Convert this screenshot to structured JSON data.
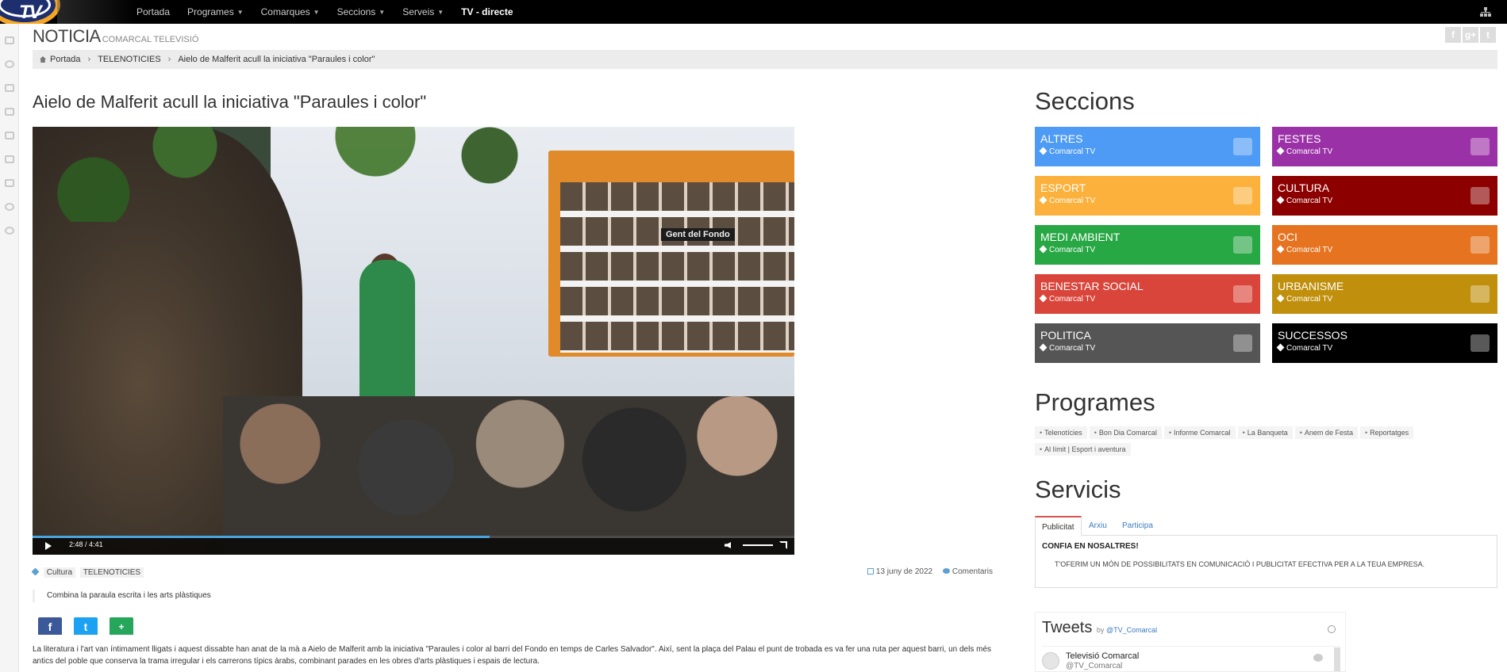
{
  "nav": {
    "logo_text": "TV",
    "items": [
      {
        "label": "Portada",
        "dropdown": false
      },
      {
        "label": "Programes",
        "dropdown": true
      },
      {
        "label": "Comarques",
        "dropdown": true
      },
      {
        "label": "Seccions",
        "dropdown": true
      },
      {
        "label": "Serveis",
        "dropdown": true
      },
      {
        "label": "TV - directe",
        "dropdown": false
      }
    ]
  },
  "header": {
    "title": "NOTICIA",
    "subtitle": "COMARCAL TELEVISIÓ",
    "social": [
      "f",
      "g+",
      "t"
    ]
  },
  "breadcrumb": [
    "Portada",
    "TELENOTICIES",
    "Aielo de Malferit acull la iniciativa \"Paraules i color\""
  ],
  "article": {
    "title": "Aielo de Malferit acull la iniciativa \"Paraules i color\"",
    "video": {
      "board_label": "Gent del Fondo",
      "current_time": "2:48",
      "time_separator": "/",
      "duration": "4:41",
      "progress": 0.6
    },
    "tags": [
      "Cultura",
      "TELENOTICIES"
    ],
    "date": "13 juny de 2022",
    "comments_label": "Comentaris",
    "lead": "Combina la paraula escrita i les arts plàstiques",
    "share": [
      "f",
      "t",
      "+"
    ],
    "body": "La literatura i l'art van íntimament lligats i aquest dissabte han anat de la mà a Aielo de Malferit amb la iniciativa \"Paraules i color al barri del Fondo en temps de Carles Salvador\". Així, sent la plaça del Palau el punt de trobada es va fer una ruta per aquest barri, un dels més antics del poble que conserva la trama irregular i els carrerons típics àrabs, combinant parades en les obres d'arts plàstiques i espais de lectura."
  },
  "sidebar": {
    "sections_title": "Seccions",
    "sections": [
      {
        "name": "ALTRES",
        "sub": "Comarcal TV",
        "color": "#4d9bf5",
        "icon": "globe-icon"
      },
      {
        "name": "FESTES",
        "sub": "Comarcal TV",
        "color": "#9b31a7",
        "icon": "bullhorn-icon"
      },
      {
        "name": "ESPORT",
        "sub": "Comarcal TV",
        "color": "#fbb13c",
        "icon": "trophy-icon"
      },
      {
        "name": "CULTURA",
        "sub": "Comarcal TV",
        "color": "#8c0000",
        "icon": "book-icon"
      },
      {
        "name": "MEDI AMBIENT",
        "sub": "Comarcal TV",
        "color": "#28a745",
        "icon": "plane-icon"
      },
      {
        "name": "OCI",
        "sub": "Comarcal TV",
        "color": "#e5731f",
        "icon": "glass-icon"
      },
      {
        "name": "BENESTAR SOCIAL",
        "sub": "Comarcal TV",
        "color": "#d9453a",
        "icon": "music-icon"
      },
      {
        "name": "URBANISME",
        "sub": "Comarcal TV",
        "color": "#c0900d",
        "icon": "euro-icon"
      },
      {
        "name": "POLITICA",
        "sub": "Comarcal TV",
        "color": "#555555",
        "icon": "gavel-icon"
      },
      {
        "name": "SUCCESSOS",
        "sub": "Comarcal TV",
        "color": "#000000",
        "icon": "camera-icon"
      }
    ],
    "programs_title": "Programes",
    "programs": [
      "Telenotícies",
      "Bon Dia Comarcal",
      "Informe Comarcal",
      "La Banqueta",
      "Anem de Festa",
      "Reportatges",
      "Al límit | Esport i aventura"
    ],
    "services_title": "Servicis",
    "service_tabs": [
      "Publicitat",
      "Arxiu",
      "Participa"
    ],
    "service_panel": {
      "heading": "CONFIA EN NOSALTRES!",
      "text": "T'OFERIM UN MÓN DE POSSIBILITATS EN COMUNICACIÓ I PUBLICITAT EFECTIVA PER A LA TEUA EMPRESA."
    },
    "tweets": {
      "title": "Tweets",
      "by": "by",
      "handle_link": "@TV_Comarcal",
      "account_name": "Televisió Comarcal",
      "account_handle": "@TV_Comarcal"
    }
  }
}
